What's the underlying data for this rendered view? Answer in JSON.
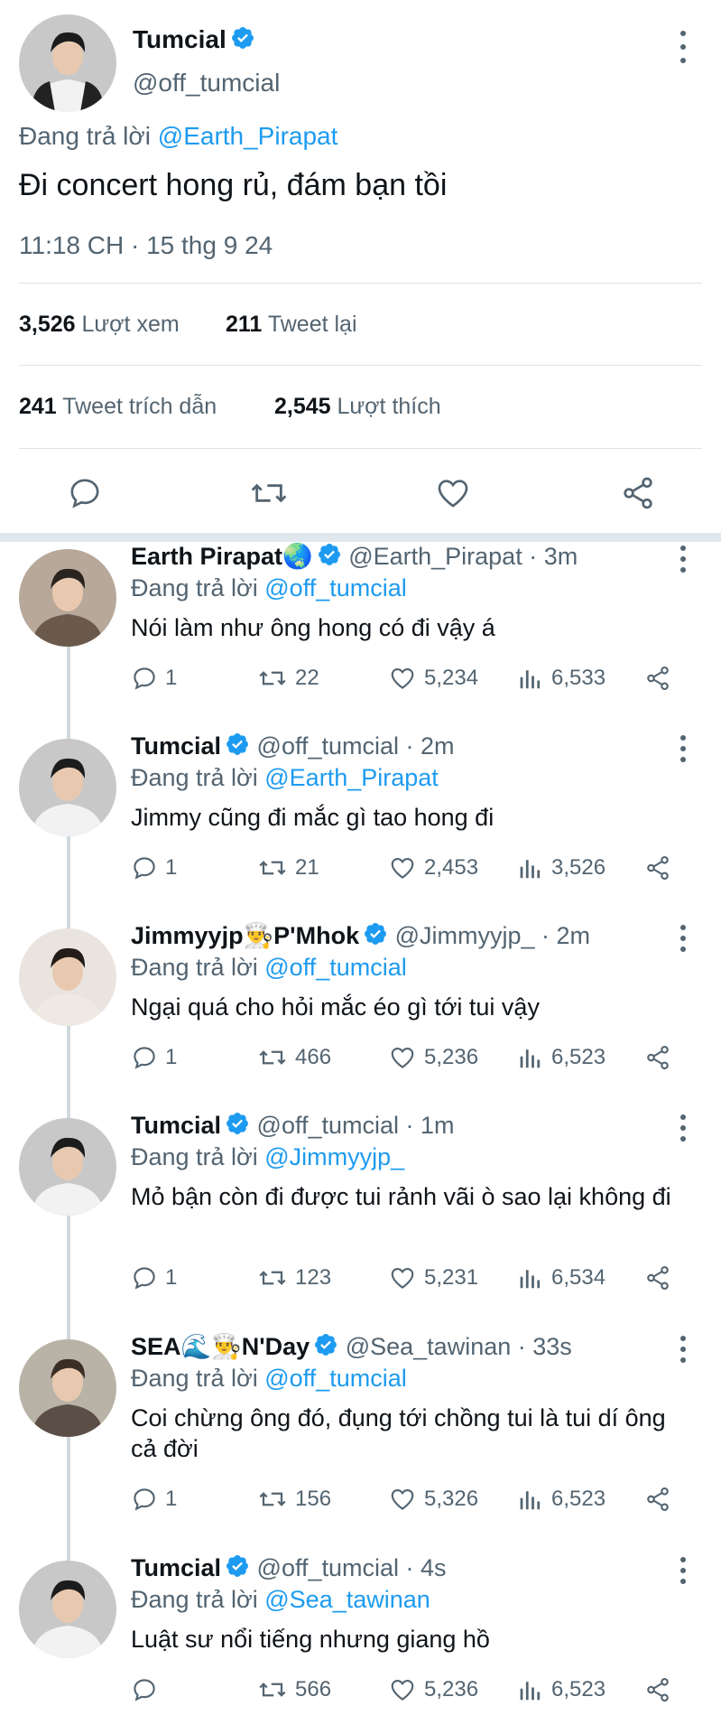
{
  "main_tweet": {
    "name": "Tumcial",
    "handle": "@off_tumcial",
    "reply_prefix": "Đang trả lời ",
    "reply_to": "@Earth_Pirapat",
    "text": "Đi concert hong rủ, đám bạn tồi",
    "timestamp": "11:18 CH · 15 thg 9 24",
    "views_num": "3,526",
    "views_label": "Lượt xem",
    "retweets_num": "211",
    "retweets_label": "Tweet lại",
    "quotes_num": "241",
    "quotes_label": "Tweet trích dẫn",
    "likes_num": "2,545",
    "likes_label": "Lượt thích"
  },
  "replies": [
    {
      "name": "Earth Pirapat🌏",
      "handle": "@Earth_Pirapat · 3m",
      "reply_prefix": "Đang trả lời ",
      "reply_to": "@off_tumcial",
      "text": "Nói làm như ông hong có đi vậy á",
      "replies": "1",
      "retweets": "22",
      "likes": "5,234",
      "views": "6,533"
    },
    {
      "name": "Tumcial",
      "handle": "@off_tumcial · 2m",
      "reply_prefix": "Đang trả lời ",
      "reply_to": "@Earth_Pirapat",
      "text": "Jimmy cũng đi mắc gì tao hong đi",
      "replies": "1",
      "retweets": "21",
      "likes": "2,453",
      "views": "3,526"
    },
    {
      "name": "Jimmyyjp👨‍🍳P'Mhok",
      "handle": "@Jimmyyjp_ · 2m",
      "reply_prefix": "Đang trả lời ",
      "reply_to": "@off_tumcial",
      "text": "Ngại quá cho hỏi mắc éo gì tới tui vậy",
      "replies": "1",
      "retweets": "466",
      "likes": "5,236",
      "views": "6,523"
    },
    {
      "name": "Tumcial",
      "handle": "@off_tumcial · 1m",
      "reply_prefix": "Đang trả lời ",
      "reply_to": "@Jimmyyjp_",
      "text": "Mỏ bận còn đi được tui rảnh vãi ò sao lại không đi",
      "replies": "1",
      "retweets": "123",
      "likes": "5,231",
      "views": "6,534"
    },
    {
      "name": "SEA🌊👨‍🍳N'Day",
      "handle": "@Sea_tawinan · 33s",
      "reply_prefix": "Đang trả lời ",
      "reply_to": "@off_tumcial",
      "text": "Coi chừng ông đó, đụng tới chồng tui là tui dí ông cả đời",
      "replies": "1",
      "retweets": "156",
      "likes": "5,326",
      "views": "6,523"
    },
    {
      "name": "Tumcial",
      "handle": "@off_tumcial · 4s",
      "reply_prefix": "Đang trả lời ",
      "reply_to": "@Sea_tawinan",
      "text": "Luật sư nổi tiếng nhưng giang hồ",
      "replies": "",
      "retweets": "566",
      "likes": "5,236",
      "views": "6,523"
    }
  ],
  "colors": {
    "accent": "#1d9bf0",
    "muted": "#536471",
    "text": "#0f1419"
  }
}
